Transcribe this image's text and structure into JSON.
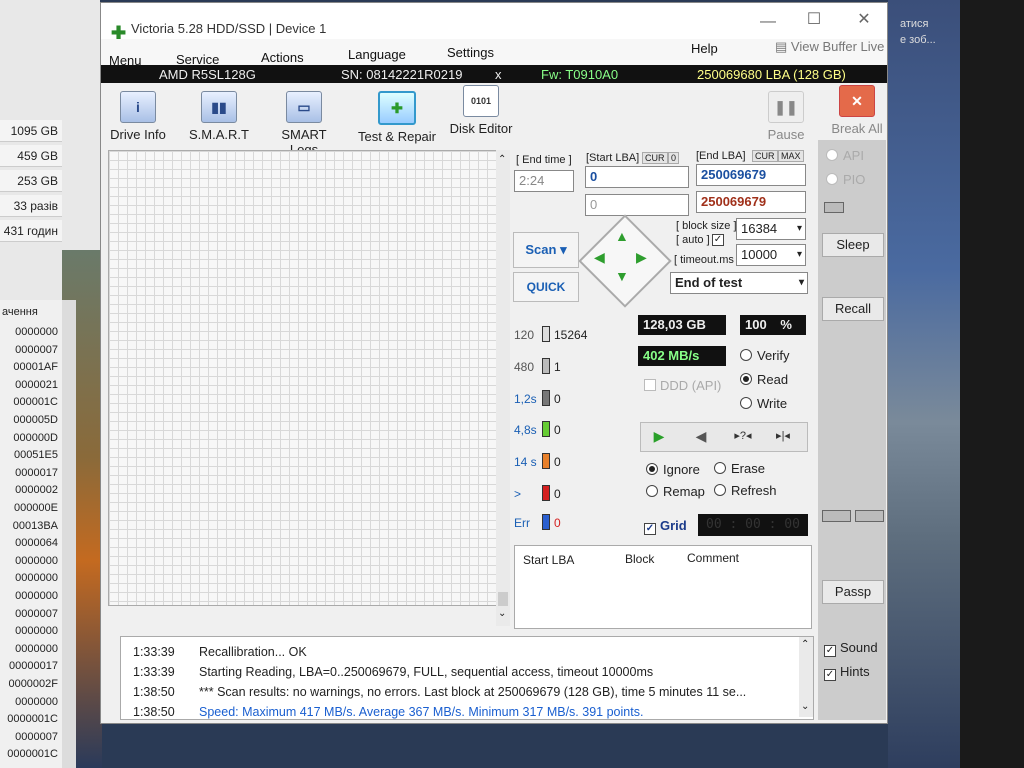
{
  "background": {
    "sizes": [
      "1095 GB",
      "459 GB",
      "253 GB",
      "33 разів",
      "431 годин"
    ],
    "list_header": "ачення",
    "list_values": [
      "0000000",
      "0000007",
      "00001AF",
      "0000021",
      "000001C",
      "000005D",
      "000000D",
      "00051E5",
      "0000017",
      "0000002",
      "000000E",
      "00013BA",
      "0000064",
      "0000000",
      "0000000",
      "0000000",
      "0000007",
      "0000000",
      "0000000",
      "00000017",
      "0000002F",
      "0000000",
      "0000001C",
      "0000007",
      "0000001C"
    ],
    "right_text1": "атися",
    "right_text2": "е зоб..."
  },
  "window": {
    "title": "Victoria 5.28 HDD/SSD | Device 1",
    "minimize": "—",
    "maximize": "☐",
    "close": "✕"
  },
  "menu": {
    "items": [
      "Menu",
      "Service",
      "Actions",
      "Language",
      "Settings",
      "Help"
    ],
    "view_buffer": "View Buffer Live"
  },
  "infobar": {
    "model": "AMD R5SL128G",
    "serial": "SN: 08142221R0219",
    "close_x": "x",
    "firmware": "Fw: T0910A0",
    "capacity": "250069680 LBA (128 GB)"
  },
  "toolbar": {
    "drive_info": "Drive Info",
    "smart": "S.M.A.R.T",
    "smart_logs": "SMART Logs",
    "test_repair": "Test & Repair",
    "disk_editor": "Disk Editor",
    "pause": "Pause",
    "break_all": "Break All"
  },
  "test": {
    "end_time_label": "[ End time ]",
    "end_time": "2:24",
    "start_lba_label": "[Start LBA]",
    "cur": "CUR",
    "zero": "0",
    "start_lba": "0",
    "start_lba_2": "0",
    "end_lba_label": "[End LBA]",
    "max": "MAX",
    "end_lba": "250069679",
    "end_lba_2": "250069679",
    "block_size_label": "[ block size ]",
    "auto_label": "[ auto ]",
    "block_size": "16384",
    "timeout_label": "[ timeout.ms ]",
    "timeout": "10000",
    "scan_button": "Scan ▾",
    "quick_button": "QUICK",
    "end_of_test": "End of test",
    "api": "API",
    "pio": "PIO"
  },
  "stats": [
    {
      "label": "120",
      "count": "15264",
      "color": "#dddddd"
    },
    {
      "label": "480",
      "count": "1",
      "color": "#bbbbbb"
    },
    {
      "label": "1,2s",
      "count": "0",
      "color": "#777777"
    },
    {
      "label": "4,8s",
      "count": "0",
      "color": "#66cc33"
    },
    {
      "label": "14 s",
      "count": "0",
      "color": "#e8802a"
    },
    {
      "label": ">",
      "count": "0",
      "color": "#d42020"
    },
    {
      "label": "Err",
      "count": "0",
      "color": "#2a5fd0"
    }
  ],
  "readouts": {
    "size": "128,03 GB",
    "percent": "100",
    "percent_unit": "%",
    "speed": "402 MB/s",
    "ddd": "DDD (API)"
  },
  "modes": {
    "verify": "Verify",
    "read": "Read",
    "write": "Write"
  },
  "actions": {
    "ignore": "Ignore",
    "erase": "Erase",
    "remap": "Remap",
    "refresh": "Refresh"
  },
  "grid": {
    "label": "Grid",
    "timer": "00 : 00 : 00"
  },
  "error_table": {
    "start_lba": "Start LBA",
    "block": "Block",
    "comment": "Comment"
  },
  "side": {
    "sleep": "Sleep",
    "recall": "Recall",
    "passp": "Passp",
    "sound": "Sound",
    "hints": "Hints"
  },
  "log": [
    {
      "time": "1:33:39",
      "text": "Recallibration... OK",
      "color": "#222222"
    },
    {
      "time": "1:33:39",
      "text": "Starting Reading, LBA=0..250069679, FULL, sequential access, timeout 10000ms",
      "color": "#222222"
    },
    {
      "time": "1:38:50",
      "text": "*** Scan results: no warnings, no errors. Last block at 250069679 (128 GB), time 5 minutes 11 se...",
      "color": "#222222"
    },
    {
      "time": "1:38:50",
      "text": "Speed: Maximum 417 MB/s. Average 367 MB/s. Minimum 317 MB/s. 391 points.",
      "color": "#1a5fd0"
    }
  ]
}
